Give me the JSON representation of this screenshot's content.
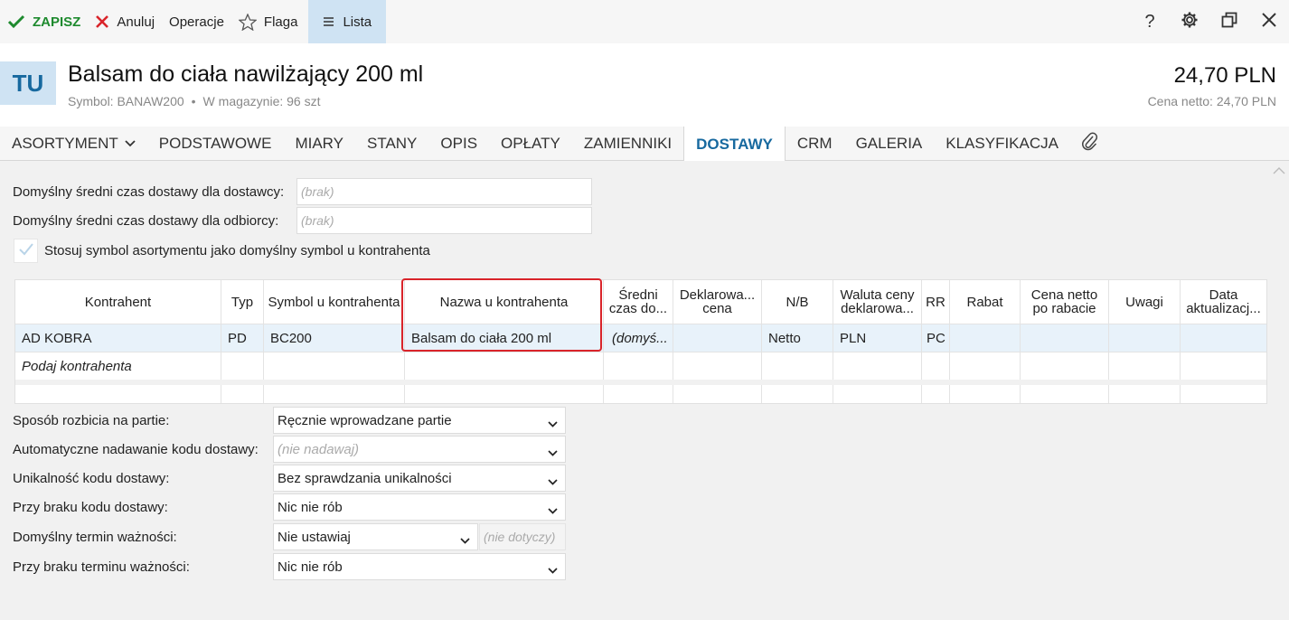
{
  "toolbar": {
    "save": "ZAPISZ",
    "cancel": "Anuluj",
    "operations": "Operacje",
    "flag": "Flaga",
    "list": "Lista",
    "help": "?"
  },
  "header": {
    "badge": "TU",
    "title": "Balsam do ciała nawilżający 200 ml",
    "symbol": "Symbol: BANAW200",
    "stock": "W magazynie: 96 szt",
    "price": "24,70 PLN",
    "net_price": "Cena netto: 24,70 PLN"
  },
  "tabs": {
    "asortyment": "ASORTYMENT",
    "podstawowe": "PODSTAWOWE",
    "miary": "MIARY",
    "stany": "STANY",
    "opis": "OPIS",
    "oplaty": "OPŁATY",
    "zamienniki": "ZAMIENNIKI",
    "dostawy": "DOSTAWY",
    "crm": "CRM",
    "galeria": "GALERIA",
    "klasyfikacja": "KLASYFIKACJA"
  },
  "fields": {
    "supplier_time_label": "Domyślny średni czas dostawy dla dostawcy:",
    "supplier_time_placeholder": "(brak)",
    "receiver_time_label": "Domyślny średni czas dostawy dla odbiorcy:",
    "receiver_time_placeholder": "(brak)",
    "use_symbol_label": "Stosuj symbol asortymentu jako domyślny symbol u kontrahenta"
  },
  "grid": {
    "headers": {
      "kontrahent": "Kontrahent",
      "typ": "Typ",
      "symbol": "Symbol u kontrahenta",
      "nazwa": "Nazwa u kontrahenta",
      "sredni": "Średni czas do...",
      "deklarowana": "Deklarowa... cena",
      "nb": "N/B",
      "waluta": "Waluta ceny deklarowa...",
      "rr": "RR",
      "rabat": "Rabat",
      "cena_netto": "Cena netto po rabacie",
      "uwagi": "Uwagi",
      "data": "Data aktualizacj..."
    },
    "row": {
      "kontrahent": "AD KOBRA",
      "typ": "PD",
      "symbol": "BC200",
      "nazwa": "Balsam do ciała 200 ml",
      "sredni": "(domyś...",
      "nb": "Netto",
      "waluta": "PLN",
      "rr": "PC"
    },
    "new_row_placeholder": "Podaj kontrahenta"
  },
  "settings": {
    "batch_label": "Sposób rozbicia na partie:",
    "batch_value": "Ręcznie wprowadzane partie",
    "auto_code_label": "Automatyczne nadawanie kodu dostawy:",
    "auto_code_value": "(nie nadawaj)",
    "unique_label": "Unikalność kodu dostawy:",
    "unique_value": "Bez sprawdzania unikalności",
    "no_code_label": "Przy braku kodu dostawy:",
    "no_code_value": "Nic nie rób",
    "expiry_label": "Domyślny termin ważności:",
    "expiry_value": "Nie ustawiaj",
    "expiry_extra": "(nie dotyczy)",
    "no_expiry_label": "Przy braku terminu ważności:",
    "no_expiry_value": "Nic nie rób"
  },
  "colors": {
    "accent": "#17699f",
    "save_green": "#1e8a2e",
    "cancel_red": "#d9242a",
    "highlight_red": "#d9242a",
    "selected_row": "#e8f2fa"
  }
}
